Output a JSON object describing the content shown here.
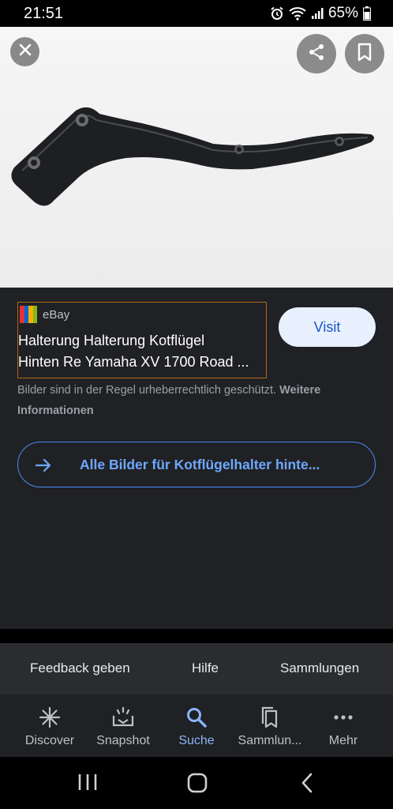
{
  "status_bar": {
    "time": "21:51",
    "battery": "65%"
  },
  "image_toolbar": {
    "close_icon": "close-icon",
    "share_icon": "share-icon",
    "bookmark_icon": "bookmark-icon"
  },
  "result": {
    "source": "eBay",
    "title_line1": "Halterung Halterung Kotflügel",
    "title_line2": "Hinten Re Yamaha XV 1700 Road ...",
    "visit_label": "Visit",
    "copyright_text": "Bilder sind in der Regel urheberrechtlich geschützt.",
    "more_info": "Weitere Informationen",
    "all_images_label": "Alle Bilder für Kotflügelhalter hinte..."
  },
  "footer_links": [
    "Feedback geben",
    "Hilfe",
    "Sammlungen"
  ],
  "bottom_nav": {
    "items": [
      {
        "label": "Discover",
        "icon": "asterisk-icon"
      },
      {
        "label": "Snapshot",
        "icon": "snapshot-icon"
      },
      {
        "label": "Suche",
        "icon": "search-icon"
      },
      {
        "label": "Sammlun...",
        "icon": "collections-icon"
      },
      {
        "label": "Mehr",
        "icon": "more-icon"
      }
    ],
    "active": "Suche"
  },
  "colors": {
    "accent": "#8ab4f8",
    "panel": "#202124",
    "source_border": "#b06a1a"
  }
}
